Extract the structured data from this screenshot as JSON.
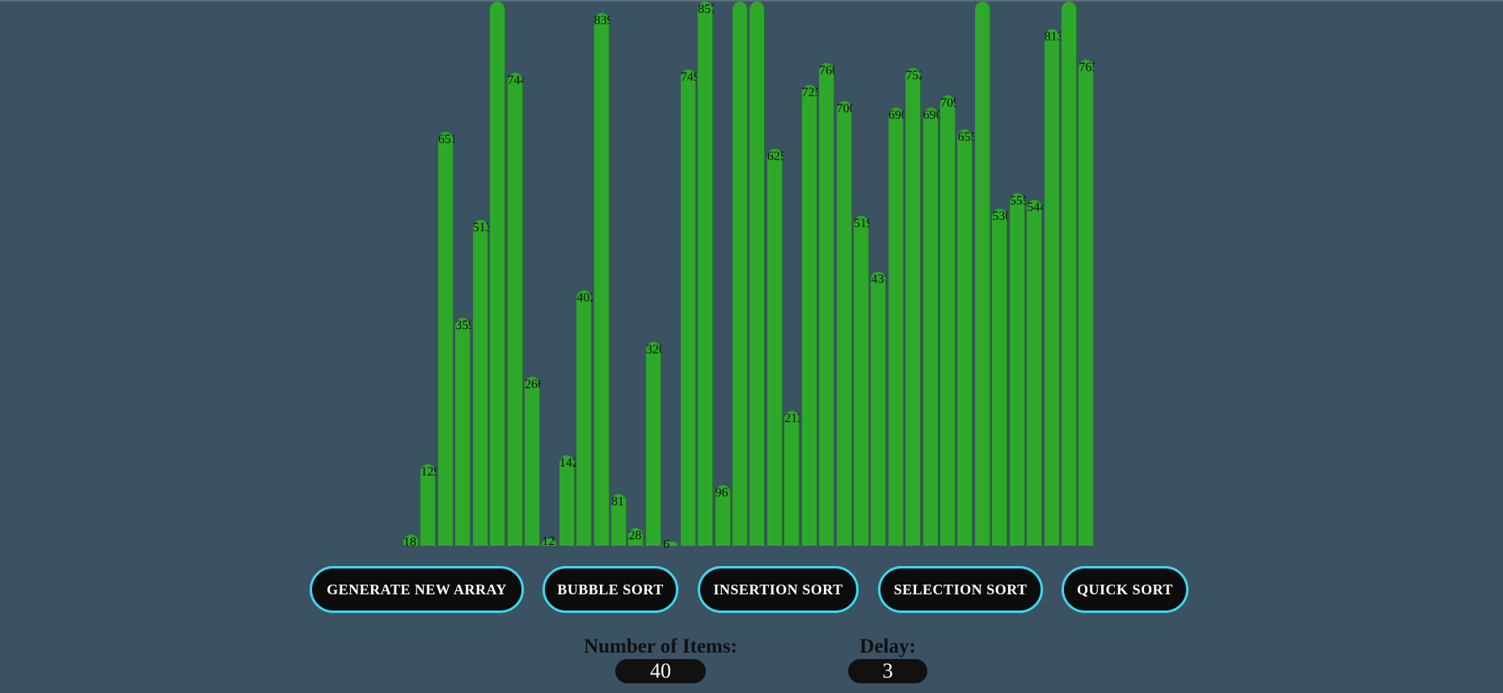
{
  "bars": [
    {
      "value": 18,
      "label": "18"
    },
    {
      "value": 129,
      "label": "129"
    },
    {
      "value": 651,
      "label": "651"
    },
    {
      "value": 359,
      "label": "359"
    },
    {
      "value": 513,
      "label": "513"
    },
    {
      "value": 950,
      "label": ""
    },
    {
      "value": 744,
      "label": "744"
    },
    {
      "value": 266,
      "label": "266"
    },
    {
      "value": 12,
      "label": "12"
    },
    {
      "value": 142,
      "label": "142"
    },
    {
      "value": 402,
      "label": "402"
    },
    {
      "value": 839,
      "label": "839"
    },
    {
      "value": 81,
      "label": "81"
    },
    {
      "value": 28,
      "label": "28"
    },
    {
      "value": 320,
      "label": "320"
    },
    {
      "value": 6,
      "label": "6"
    },
    {
      "value": 749,
      "label": "749"
    },
    {
      "value": 857,
      "label": "857"
    },
    {
      "value": 96,
      "label": "96"
    },
    {
      "value": 950,
      "label": ""
    },
    {
      "value": 950,
      "label": ""
    },
    {
      "value": 625,
      "label": "625"
    },
    {
      "value": 213,
      "label": "213"
    },
    {
      "value": 725,
      "label": "725"
    },
    {
      "value": 760,
      "label": "760"
    },
    {
      "value": 700,
      "label": "700"
    },
    {
      "value": 519,
      "label": "519"
    },
    {
      "value": 431,
      "label": "431"
    },
    {
      "value": 690,
      "label": "690"
    },
    {
      "value": 752,
      "label": "752"
    },
    {
      "value": 690,
      "label": "690"
    },
    {
      "value": 709,
      "label": "709"
    },
    {
      "value": 655,
      "label": "655"
    },
    {
      "value": 950,
      "label": ""
    },
    {
      "value": 530,
      "label": "530"
    },
    {
      "value": 555,
      "label": "555"
    },
    {
      "value": 544,
      "label": "544"
    },
    {
      "value": 813,
      "label": "813"
    },
    {
      "value": 950,
      "label": ""
    },
    {
      "value": 765,
      "label": "765"
    }
  ],
  "buttons": {
    "generate": "GENERATE NEW ARRAY",
    "bubble": "BUBBLE SORT",
    "insertion": "INSERTION SORT",
    "selection": "SELECTION SORT",
    "quick": "QUICK SORT"
  },
  "controls": {
    "items_label": "Number of Items:",
    "items_value": "40",
    "delay_label": "Delay:",
    "delay_value": "3"
  },
  "colors": {
    "background": "#3b5262",
    "bar": "#2ea82a",
    "button_border": "#3ad7f2",
    "button_bg": "#0c0c0c"
  }
}
